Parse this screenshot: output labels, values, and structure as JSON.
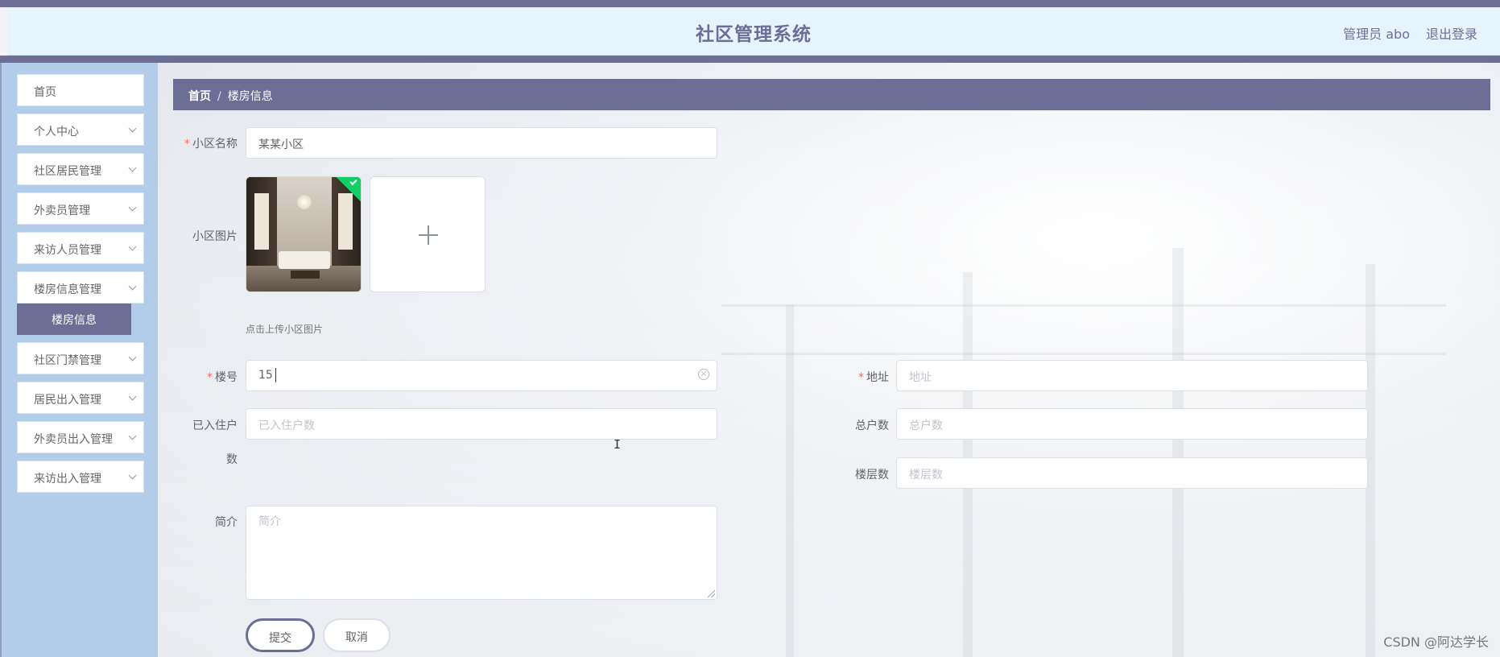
{
  "header": {
    "title": "社区管理系统",
    "user": "管理员 abo",
    "logout": "退出登录"
  },
  "sidebar": {
    "items": [
      {
        "label": "首页",
        "has_chevron": false
      },
      {
        "label": "个人中心",
        "has_chevron": true
      },
      {
        "label": "社区居民管理",
        "has_chevron": true
      },
      {
        "label": "外卖员管理",
        "has_chevron": true
      },
      {
        "label": "来访人员管理",
        "has_chevron": true
      },
      {
        "label": "楼房信息管理",
        "has_chevron": true
      },
      {
        "label": "社区门禁管理",
        "has_chevron": true
      },
      {
        "label": "居民出入管理",
        "has_chevron": true
      },
      {
        "label": "外卖员出入管理",
        "has_chevron": true
      },
      {
        "label": "来访出入管理",
        "has_chevron": true
      }
    ],
    "active_sub": "楼房信息"
  },
  "breadcrumb": {
    "home": "首页",
    "separator": "/",
    "current": "楼房信息"
  },
  "form": {
    "community_name": {
      "label": "小区名称",
      "value": "某某小区",
      "required": true
    },
    "community_image": {
      "label": "小区图片",
      "hint": "点击上传小区图片"
    },
    "building_no": {
      "label": "楼号",
      "value": "15",
      "required": true
    },
    "address": {
      "label": "地址",
      "placeholder": "地址",
      "required": true
    },
    "occupied_households": {
      "label_line1": "已入住户",
      "label_line2": "数",
      "placeholder": "已入住户数"
    },
    "total_households": {
      "label": "总户数",
      "placeholder": "总户数"
    },
    "floors": {
      "label": "楼层数",
      "placeholder": "楼层数"
    },
    "intro": {
      "label": "简介",
      "placeholder": "简介"
    },
    "submit_label": "提交",
    "cancel_label": "取消"
  },
  "watermark": "CSDN @阿达学长",
  "colors": {
    "theme": "#6d6e96",
    "header_bg": "#e6f4fd",
    "sidebar_bg": "#b2cdea",
    "required": "#f56c6c",
    "upload_success": "#13ce66"
  }
}
